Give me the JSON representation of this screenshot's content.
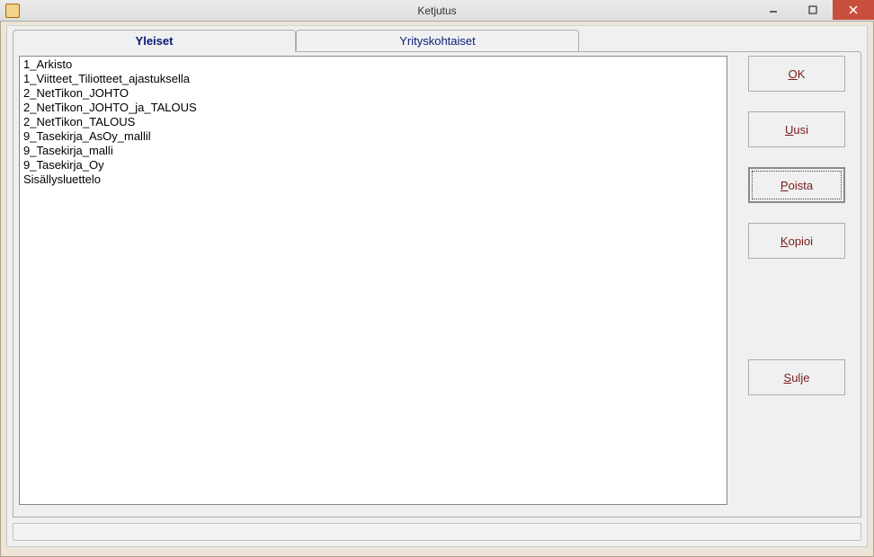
{
  "window": {
    "title": "Ketjutus",
    "app_icon_text": ""
  },
  "tabs": {
    "general": "Yleiset",
    "company": "Yrityskohtaiset"
  },
  "list": {
    "items": [
      "1_Arkisto",
      "1_Viitteet_Tiliotteet_ajastuksella",
      "2_NetTikon_JOHTO",
      "2_NetTikon_JOHTO_ja_TALOUS",
      "2_NetTikon_TALOUS",
      "9_Tasekirja_AsOy_mallil",
      "9_Tasekirja_malli",
      "9_Tasekirja_Oy",
      "Sisällysluettelo"
    ]
  },
  "buttons": {
    "ok_hot": "O",
    "ok_rest": "K",
    "new_hot": "U",
    "new_rest": "usi",
    "delete_hot": "P",
    "delete_rest": "oista",
    "copy_hot": "K",
    "copy_rest": "opioi",
    "close_hot": "S",
    "close_rest": "ulje"
  }
}
